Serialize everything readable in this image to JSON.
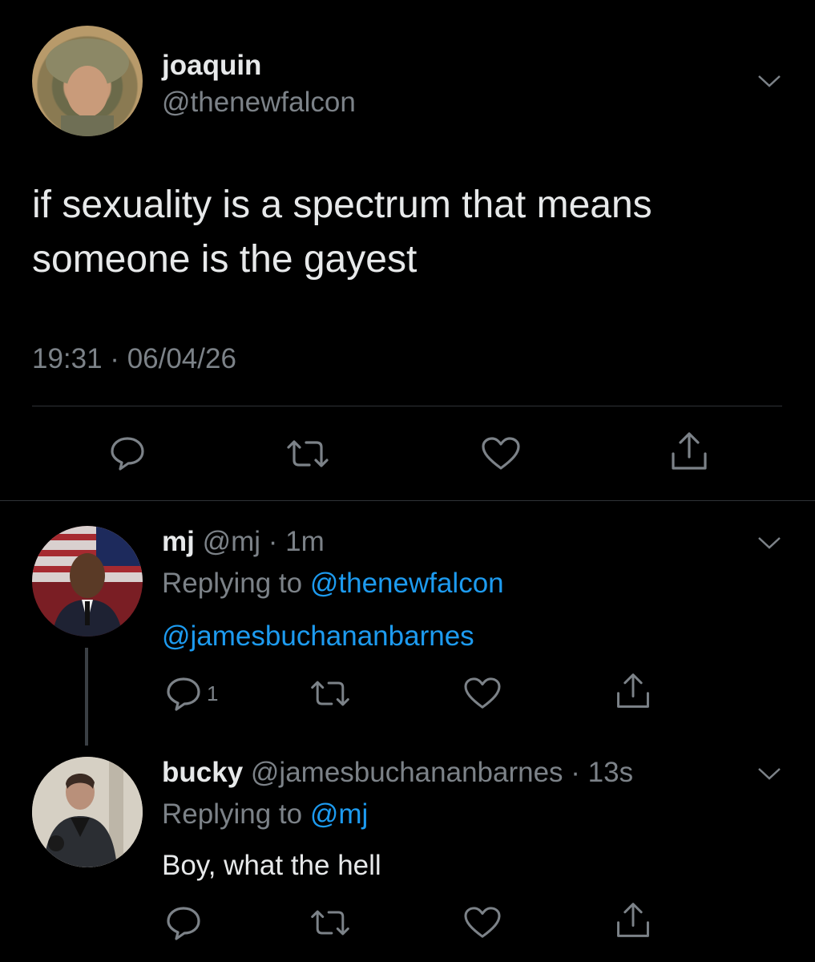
{
  "main_tweet": {
    "display_name": "joaquin",
    "handle": "@thenewfalcon",
    "text_line1": "if sexuality is a spectrum that means",
    "text_line2": "someone is the gayest",
    "timestamp": "19:31 · 06/04/26"
  },
  "replies": [
    {
      "display_name": "mj",
      "handle": "@mj",
      "time": "· 1m",
      "replying_label": "Replying to",
      "replying_to": "@thenewfalcon",
      "text": "@jamesbuchananbarnes",
      "reply_count": "1"
    },
    {
      "display_name": "bucky",
      "handle": "@jamesbuchananbarnes",
      "time": "· 13s",
      "replying_label": "Replying to",
      "replying_to": "@mj",
      "text": "Boy, what the hell"
    }
  ],
  "icons": [
    "chevron-down-icon",
    "reply-icon",
    "retweet-icon",
    "like-icon",
    "share-icon"
  ],
  "colors": {
    "background": "#000000",
    "text": "#e7e9ea",
    "muted": "#7c8288",
    "link": "#1d9bf0",
    "divider": "#2f3336"
  }
}
